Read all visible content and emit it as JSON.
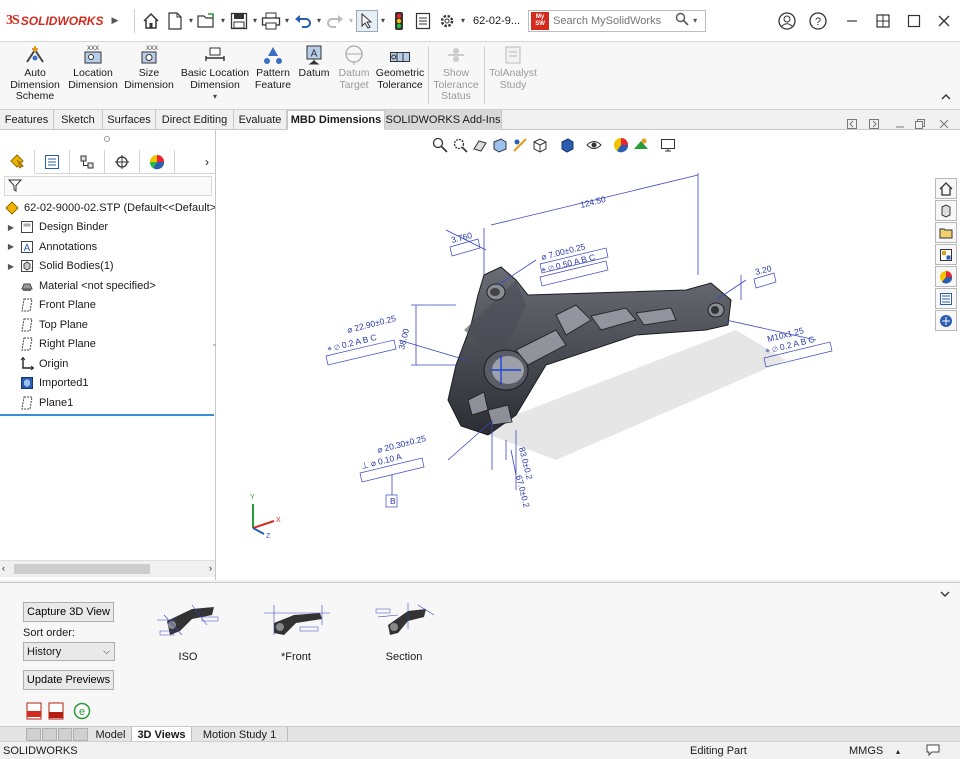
{
  "app": {
    "brand": "SOLIDWORKS",
    "brand_mark": "3S",
    "file_short": "62-02-9...",
    "accent": "#d52b1e"
  },
  "search": {
    "placeholder": "Search MySolidWorks",
    "badge": "My SW"
  },
  "ribbon": {
    "buttons": [
      {
        "label": "Auto Dimension Scheme",
        "icon": "auto-dimension-icon",
        "enabled": true
      },
      {
        "label": "Location Dimension",
        "icon": "location-dimension-icon",
        "enabled": true
      },
      {
        "label": "Size Dimension",
        "icon": "size-dimension-icon",
        "enabled": true
      },
      {
        "label": "Basic Location Dimension",
        "icon": "basic-location-icon",
        "enabled": true
      },
      {
        "label": "Pattern Feature",
        "icon": "pattern-feature-icon",
        "enabled": true
      },
      {
        "label": "Datum",
        "icon": "datum-icon",
        "enabled": true
      },
      {
        "label": "Datum Target",
        "icon": "datum-target-icon",
        "enabled": false
      },
      {
        "label": "Geometric Tolerance",
        "icon": "geometric-tolerance-icon",
        "enabled": true
      },
      {
        "label": "Show Tolerance Status",
        "icon": "tolerance-status-icon",
        "enabled": false
      },
      {
        "label": "TolAnalyst Study",
        "icon": "tolanalyst-icon",
        "enabled": false
      }
    ]
  },
  "tabs": [
    {
      "label": "Features"
    },
    {
      "label": "Sketch"
    },
    {
      "label": "Surfaces"
    },
    {
      "label": "Direct Editing"
    },
    {
      "label": "Evaluate"
    },
    {
      "label": "MBD Dimensions"
    },
    {
      "label": "SOLIDWORKS Add-Ins"
    }
  ],
  "active_tab": "MBD Dimensions",
  "tree": {
    "root": "62-02-9000-02.STP  (Default<<Default>_",
    "items": [
      {
        "label": "Design Binder",
        "icon": "design-binder-icon",
        "expandable": true
      },
      {
        "label": "Annotations",
        "icon": "annotations-icon",
        "expandable": true
      },
      {
        "label": "Solid Bodies(1)",
        "icon": "solid-bodies-icon",
        "expandable": true
      },
      {
        "label": "Material <not specified>",
        "icon": "material-icon",
        "expandable": false
      },
      {
        "label": "Front Plane",
        "icon": "plane-icon",
        "expandable": false
      },
      {
        "label": "Top Plane",
        "icon": "plane-icon",
        "expandable": false
      },
      {
        "label": "Right Plane",
        "icon": "plane-icon",
        "expandable": false
      },
      {
        "label": "Origin",
        "icon": "origin-icon",
        "expandable": false
      },
      {
        "label": "Imported1",
        "icon": "imported-body-icon",
        "expandable": false
      },
      {
        "label": "Plane1",
        "icon": "plane-icon",
        "expandable": false
      }
    ]
  },
  "viewport": {
    "annotations": {
      "dim_124": "124.50",
      "dim_7": "⌀ 7.00±0.25",
      "ftc_top": "⌖ ⌀ 0.50 A B C",
      "dim_3": "3.20",
      "dim_3_8": "3.760",
      "dim_22": "⌀ 22.90±0.25",
      "ftc_left": "⌖ ⌀ 0.2 A B C",
      "dim_38": "38.00",
      "dim_m10": "M10x1.25",
      "ftc_right": "⌖ ⌀ 0.2 A B C",
      "dim_20": "⌀ 20.30±0.25",
      "ftc_bottom": "⊥ ⌀ 0.10 A",
      "datum_b": "B",
      "dim_83": "83.0±0.2",
      "dim_67": "67.0±0.2",
      "axis_y": "Y",
      "axis_x": "X",
      "axis_z": "Z"
    }
  },
  "views": {
    "capture_label": "Capture 3D View",
    "sort_label": "Sort order:",
    "sort_value": "History",
    "update_label": "Update Previews",
    "thumbnails": [
      {
        "label": "ISO"
      },
      {
        "label": "*Front"
      },
      {
        "label": "Section"
      }
    ]
  },
  "model_tabs": [
    {
      "label": "Model"
    },
    {
      "label": "3D Views"
    },
    {
      "label": "Motion Study 1"
    }
  ],
  "status": {
    "left": "SOLIDWORKS",
    "mode": "Editing Part",
    "units": "MMGS"
  }
}
